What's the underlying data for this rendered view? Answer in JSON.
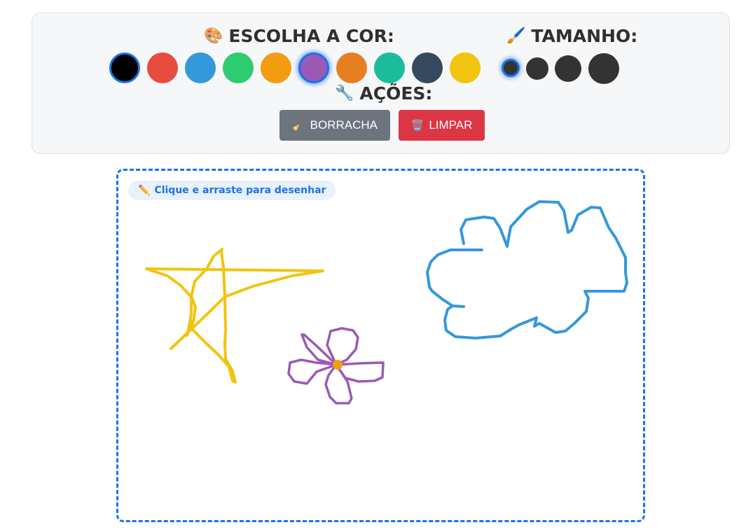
{
  "toolbar": {
    "colors_title": "ESCOLHA A COR:",
    "colors_icon": "palette-icon",
    "size_title": "TAMANHO:",
    "size_icon": "brush-icon",
    "actions_title": "AÇÕES:",
    "actions_icon": "wrench-icon",
    "colors": [
      {
        "name": "black",
        "hex": "#000000",
        "selected": true,
        "glow": false
      },
      {
        "name": "red",
        "hex": "#e74c3c",
        "selected": false,
        "glow": false
      },
      {
        "name": "blue",
        "hex": "#3498db",
        "selected": false,
        "glow": false
      },
      {
        "name": "green",
        "hex": "#2ecc71",
        "selected": false,
        "glow": false
      },
      {
        "name": "orange",
        "hex": "#f39c12",
        "selected": false,
        "glow": false
      },
      {
        "name": "purple",
        "hex": "#9b59b6",
        "selected": true,
        "glow": true
      },
      {
        "name": "dark-orange",
        "hex": "#e67e22",
        "selected": false,
        "glow": false
      },
      {
        "name": "teal",
        "hex": "#1abc9c",
        "selected": false,
        "glow": false
      },
      {
        "name": "navy",
        "hex": "#34495e",
        "selected": false,
        "glow": false
      },
      {
        "name": "yellow",
        "hex": "#f1c40f",
        "selected": false,
        "glow": false
      }
    ],
    "sizes": [
      {
        "name": "small",
        "selected": true
      },
      {
        "name": "medium",
        "selected": false
      },
      {
        "name": "large",
        "selected": false
      },
      {
        "name": "xlarge",
        "selected": false
      }
    ],
    "eraser_label": "BORRACHA",
    "eraser_icon": "broom-icon",
    "clear_label": "LIMPAR",
    "clear_icon": "trash-icon"
  },
  "canvas": {
    "hint": "Clique e arraste para desenhar",
    "hint_icon": "pencil-icon",
    "accent_color": "#1a73e8",
    "strokes": [
      {
        "name": "star-drawing",
        "color": "#f1c40f"
      },
      {
        "name": "flower-petals",
        "color": "#9b59b6"
      },
      {
        "name": "flower-center",
        "color": "#f39c12"
      },
      {
        "name": "cloud-drawing",
        "color": "#3498db"
      }
    ]
  }
}
